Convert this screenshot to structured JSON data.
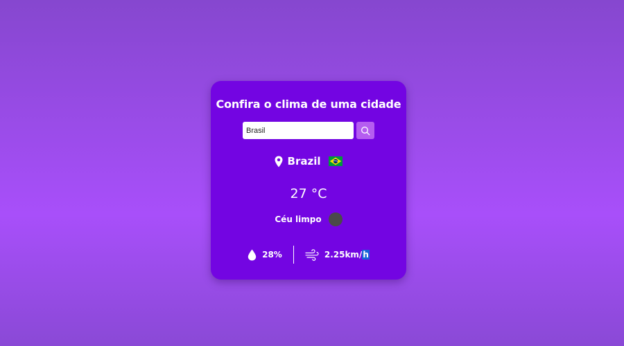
{
  "app": {
    "title": "Confira o clima de uma cidade"
  },
  "search": {
    "value": "Brasil",
    "placeholder": "",
    "button_icon": "search-icon"
  },
  "location": {
    "icon": "map-pin-icon",
    "city": "Brazil",
    "flag_icon": "brazil-flag-icon"
  },
  "weather": {
    "temperature": "27 °C",
    "description": "Céu limpo",
    "icon": "weather-icon"
  },
  "details": {
    "humidity_icon": "droplet-icon",
    "humidity": "28%",
    "wind_icon": "wind-icon",
    "wind_value": "2.25km/",
    "wind_unit_h": "h"
  },
  "colors": {
    "card": "#7305e2",
    "button": "#b55df0",
    "background_top": "#8647cf",
    "background_mid": "#a84ffa"
  }
}
